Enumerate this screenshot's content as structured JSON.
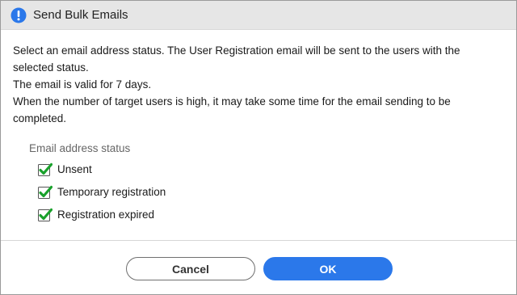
{
  "dialog": {
    "title": "Send Bulk Emails",
    "title_icon": "info-exclamation-icon",
    "accent_color": "#2b78ea",
    "message": {
      "line1": "Select an email address status. The User Registration email will be sent to the users with the",
      "line2": "selected status.",
      "line3": "The email is valid for 7 days.",
      "line4": "When the number of target users is high, it may take some time for the email sending to be",
      "line5": "completed."
    },
    "status_group": {
      "label": "Email address status",
      "options": [
        {
          "label": "Unsent",
          "checked": true
        },
        {
          "label": "Temporary registration",
          "checked": true
        },
        {
          "label": "Registration expired",
          "checked": true
        }
      ]
    },
    "buttons": {
      "cancel_label": "Cancel",
      "ok_label": "OK"
    }
  }
}
